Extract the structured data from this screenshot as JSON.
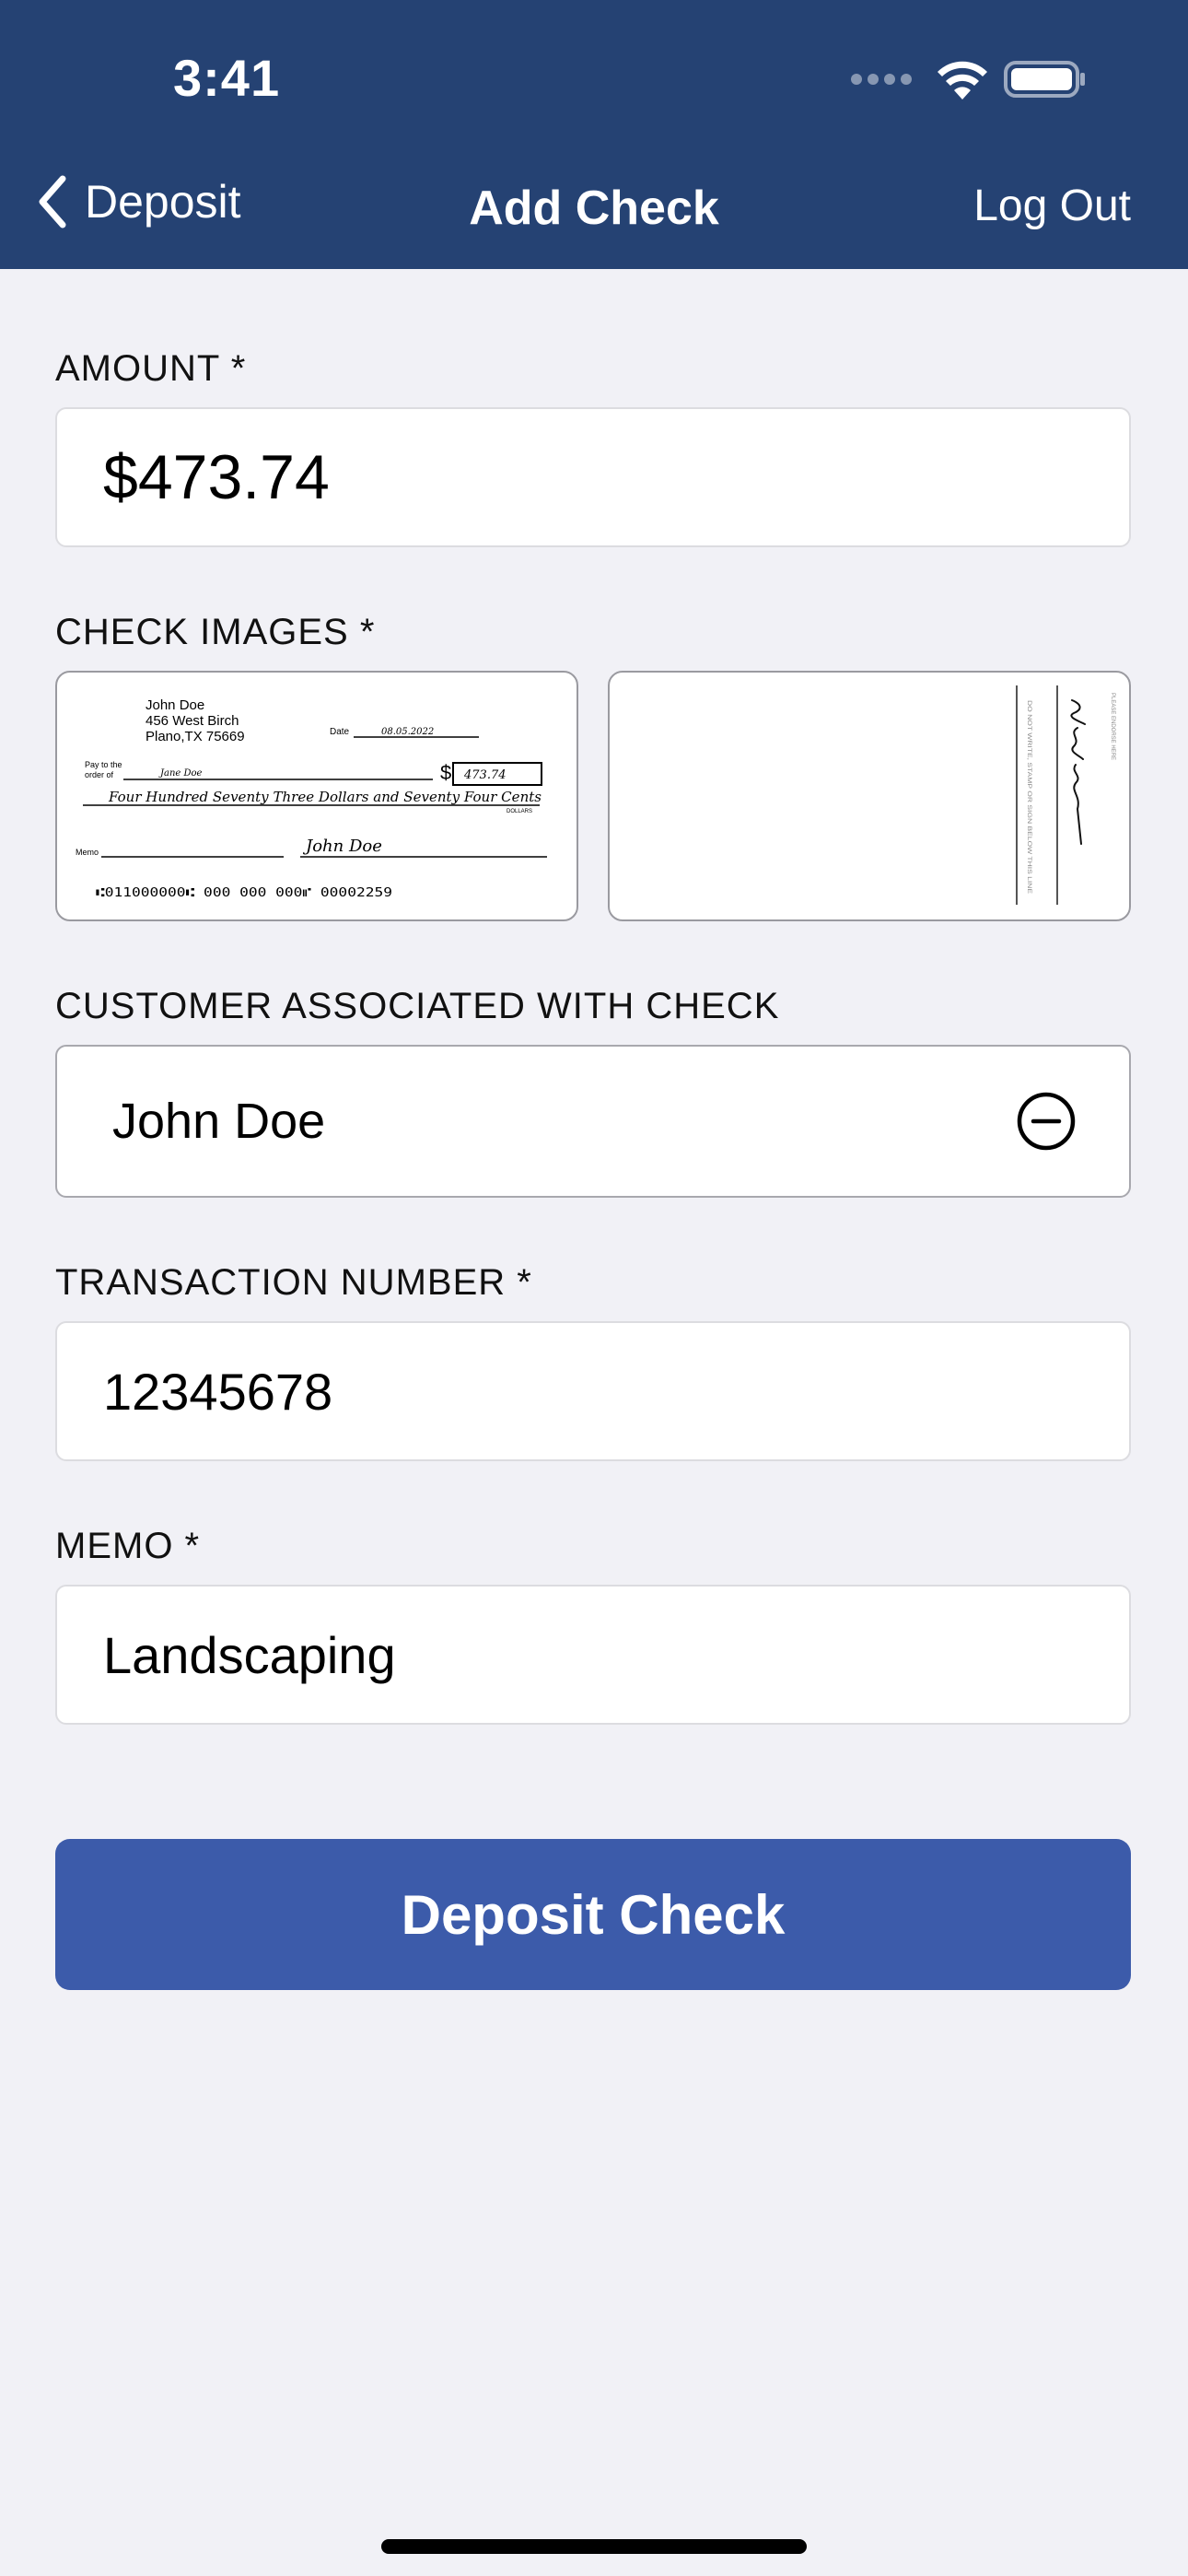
{
  "status_bar": {
    "time": "3:41"
  },
  "nav": {
    "back_label": "Deposit",
    "title": "Add Check",
    "logout_label": "Log Out"
  },
  "form": {
    "amount": {
      "label": "AMOUNT *",
      "value": "$473.74"
    },
    "check_images": {
      "label": "CHECK IMAGES *",
      "front": {
        "name": "John Doe",
        "address1": "456 West Birch",
        "address2": "Plano,TX 75669",
        "date_label": "Date",
        "date": "08.05.2022",
        "pay_to_label_1": "Pay to the",
        "pay_to_label_2": "order of",
        "payee": "Jane Doe",
        "dollar_sign": "$",
        "amount_box": "473.74",
        "written_amount": "Four Hundred Seventy Three Dollars and Seventy Four Cents",
        "dollars_label": "DOLLARS",
        "memo_label": "Memo",
        "signature": "John Doe",
        "micr_line": "⑆011000000⑆ 000 000 000⑈ 00002259"
      },
      "back": {
        "endorse_text": "PLEASE ENDORSE HERE",
        "restriction_text": "DO NOT WRITE, STAMP OR SIGN BELOW THIS LINE"
      }
    },
    "customer": {
      "label": "CUSTOMER ASSOCIATED WITH CHECK",
      "value": "John Doe"
    },
    "transaction_number": {
      "label": "TRANSACTION NUMBER *",
      "value": "12345678"
    },
    "memo": {
      "label": "MEMO *",
      "value": "Landscaping"
    }
  },
  "actions": {
    "deposit_label": "Deposit Check"
  },
  "colors": {
    "header_bg": "#254273",
    "button_bg": "#3c5baa",
    "page_bg": "#f1f1f6"
  }
}
